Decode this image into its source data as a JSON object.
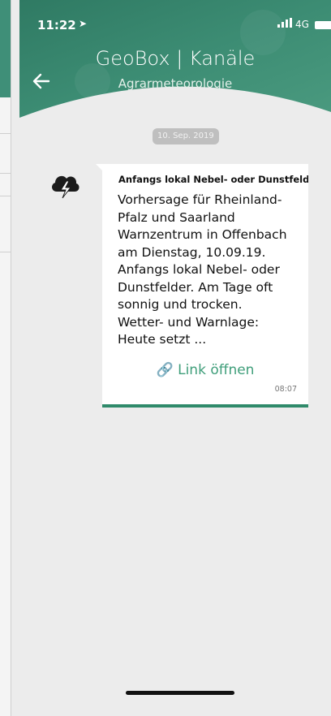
{
  "status_bar": {
    "time": "11:22",
    "network": "4G"
  },
  "header": {
    "title": "GeoBox | Kanäle",
    "subtitle": "Agrarmeteorologie"
  },
  "date_badge": "10. Sep. 2019",
  "message": {
    "title": "Anfangs lokal Nebel- oder Dunstfelder",
    "body": "Vorhersage für Rheinland-\nPfalz und Saarland\nWarnzentrum in Offenbach\nam Dienstag, 10.09.19.\nAnfangs lokal Nebel- oder\nDunstfelder. Am Tage oft\nsonnig und trocken.\nWetter- und Warnlage:\nHeute setzt ...",
    "link_label": "Link öffnen",
    "time": "08:07"
  },
  "colors": {
    "accent": "#3f9e7a",
    "header_green": "#3a8a70",
    "bar": "#2f8a6a"
  },
  "icons": [
    "location-arrow-icon",
    "signal-icon",
    "battery-icon",
    "back-arrow-icon",
    "thunderstorm-icon",
    "link-icon"
  ]
}
